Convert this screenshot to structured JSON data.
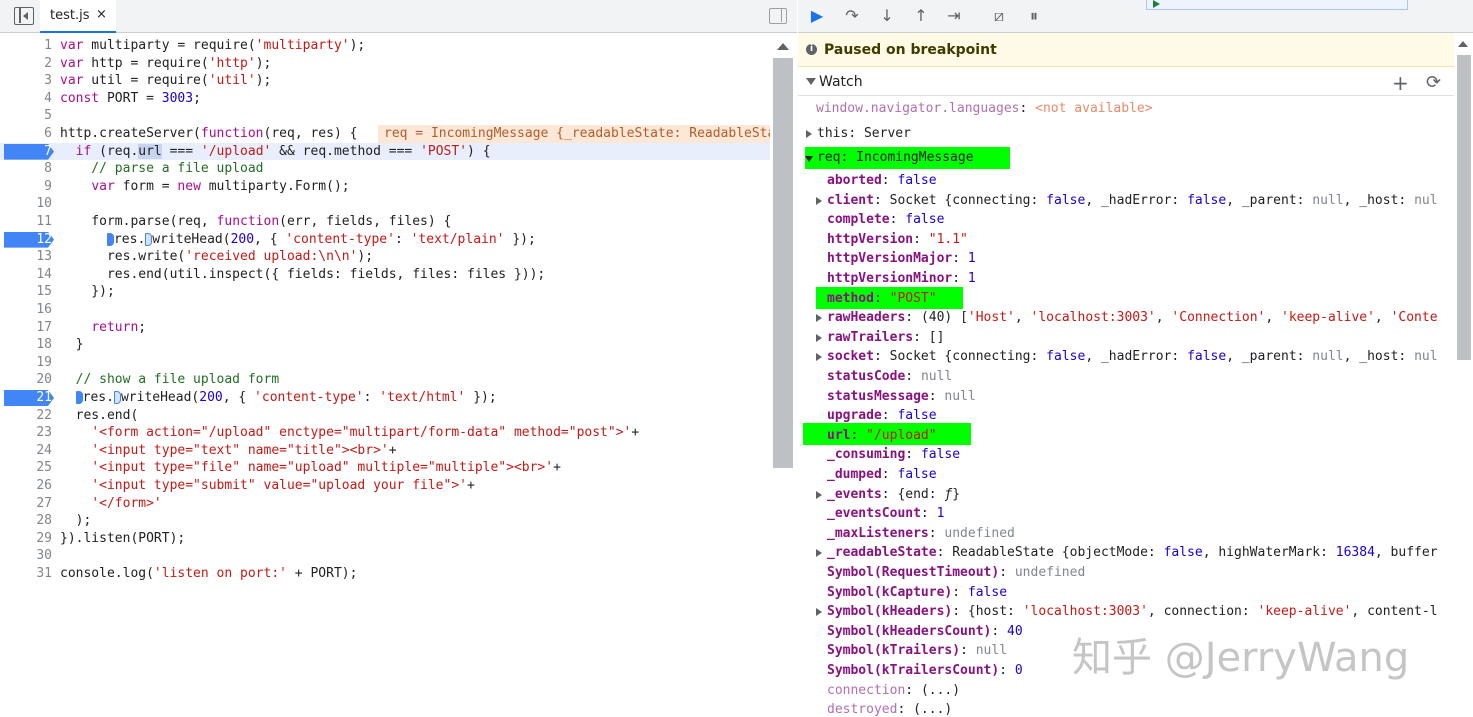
{
  "editor": {
    "tab_label": "test.js",
    "tab_close": "×",
    "lines": [
      {
        "n": "1"
      },
      {
        "n": "2"
      },
      {
        "n": "3"
      },
      {
        "n": "4"
      },
      {
        "n": "5"
      },
      {
        "n": "6"
      },
      {
        "n": "7"
      },
      {
        "n": "8"
      },
      {
        "n": "9"
      },
      {
        "n": "10"
      },
      {
        "n": "11"
      },
      {
        "n": "12"
      },
      {
        "n": "13"
      },
      {
        "n": "14"
      },
      {
        "n": "15"
      },
      {
        "n": "16"
      },
      {
        "n": "17"
      },
      {
        "n": "18"
      },
      {
        "n": "19"
      },
      {
        "n": "20"
      },
      {
        "n": "21"
      },
      {
        "n": "22"
      },
      {
        "n": "23"
      },
      {
        "n": "24"
      },
      {
        "n": "25"
      },
      {
        "n": "26"
      },
      {
        "n": "27"
      },
      {
        "n": "28"
      },
      {
        "n": "29"
      },
      {
        "n": "30"
      },
      {
        "n": "31"
      }
    ],
    "code": {
      "l1a": "var",
      "l1b": " multiparty = require(",
      "l1c": "'multiparty'",
      "l1d": ");",
      "l2a": "var",
      "l2b": " http = require(",
      "l2c": "'http'",
      "l2d": ");",
      "l3a": "var",
      "l3b": " util = require(",
      "l3c": "'util'",
      "l3d": ");",
      "l4a": "const",
      "l4b": " PORT = ",
      "l4c": "3003",
      "l4d": ";",
      "l6a": "http.createServer(",
      "l6b": "function",
      "l6c": "(req, res) {",
      "l6_inline": "req = IncomingMessage {_readableState: ReadableState",
      "l7a": "  ",
      "l7b": "if",
      "l7c": " (req.",
      "l7d": "url",
      "l7e": " === ",
      "l7f": "'/upload'",
      "l7g": " && req.method === ",
      "l7h": "'POST'",
      "l7i": ") {",
      "l8": "    // parse a file upload",
      "l9a": "    ",
      "l9b": "var",
      "l9c": " form = ",
      "l9d": "new",
      "l9e": " multiparty.Form();",
      "l11a": "    form.parse(req, ",
      "l11b": "function",
      "l11c": "(err, fields, files) {",
      "l12a": "res.",
      "l12b": "writeHead(",
      "l12c": "200",
      "l12d": ", { ",
      "l12e": "'content-type'",
      "l12f": ": ",
      "l12g": "'text/plain'",
      "l12h": " });",
      "l13a": "      res.write(",
      "l13b": "'received upload:\\n\\n'",
      "l13c": ");",
      "l14": "      res.end(util.inspect({ fields: fields, files: files }));",
      "l15": "    });",
      "l17a": "    ",
      "l17b": "return",
      "l17c": ";",
      "l18": "  }",
      "l20": "  // show a file upload form",
      "l21a": "res.",
      "l21b": "writeHead(",
      "l21c": "200",
      "l21d": ", { ",
      "l21e": "'content-type'",
      "l21f": ": ",
      "l21g": "'text/html'",
      "l21h": " });",
      "l22": "  res.end(",
      "l23a": "    ",
      "l23b": "'<form action=\"/upload\" enctype=\"multipart/form-data\" method=\"post\">'",
      "l23c": "+",
      "l24a": "    ",
      "l24b": "'<input type=\"text\" name=\"title\"><br>'",
      "l24c": "+",
      "l25a": "    ",
      "l25b": "'<input type=\"file\" name=\"upload\" multiple=\"multiple\"><br>'",
      "l25c": "+",
      "l26a": "    ",
      "l26b": "'<input type=\"submit\" value=\"upload your file\">'",
      "l26c": "+",
      "l27a": "    ",
      "l27b": "'</form>'",
      "l28": "  );",
      "l29": "}).listen(PORT);",
      "l31a": "console.log(",
      "l31b": "'listen on port:'",
      "l31c": " + PORT);"
    }
  },
  "debugger": {
    "paused_text": "Paused on breakpoint",
    "info_glyph": "i",
    "watch_label": "Watch",
    "watch_add": "+",
    "watch_refresh": "⟳",
    "buttons": {
      "resume": "▶",
      "step_over": "↷",
      "step_into": "↓",
      "step_out": "↑",
      "step": "⇥",
      "deactivate": "⧄",
      "pause_exceptions": "⏸"
    }
  },
  "watch": {
    "r0_name": "window.navigator.languages",
    "r0_sep": ": ",
    "r0_val": "<not available>",
    "r1_name": "this",
    "r1_sep": ": ",
    "r1_val": "Server",
    "r2_name": "req",
    "r2_sep": ": ",
    "r2_val": "IncomingMessage",
    "aborted_n": "aborted",
    "aborted_v": "false",
    "client_n": "client",
    "client_v1": "Socket {connecting: ",
    "client_v2": "false",
    "client_v3": ", _hadError: ",
    "client_v4": "false",
    "client_v5": ", _parent: ",
    "client_v6": "null",
    "client_v7": ", _host: ",
    "client_v8": "nul",
    "complete_n": "complete",
    "complete_v": "false",
    "httpVersion_n": "httpVersion",
    "httpVersion_v": "\"1.1\"",
    "httpVersionMajor_n": "httpVersionMajor",
    "httpVersionMajor_v": "1",
    "httpVersionMinor_n": "httpVersionMinor",
    "httpVersionMinor_v": "1",
    "method_n": "method",
    "method_v": "\"POST\"",
    "rawHeaders_n": "rawHeaders",
    "rawHeaders_v1": "(40) [",
    "rawHeaders_v2": "'Host'",
    "rawHeaders_v3": ", ",
    "rawHeaders_v4": "'localhost:3003'",
    "rawHeaders_v5": ", ",
    "rawHeaders_v6": "'Connection'",
    "rawHeaders_v7": ", ",
    "rawHeaders_v8": "'keep-alive'",
    "rawHeaders_v9": ", ",
    "rawHeaders_v10": "'Conte",
    "rawTrailers_n": "rawTrailers",
    "rawTrailers_v": "[]",
    "socket_n": "socket",
    "socket_v1": "Socket {connecting: ",
    "socket_v2": "false",
    "socket_v3": ", _hadError: ",
    "socket_v4": "false",
    "socket_v5": ", _parent: ",
    "socket_v6": "null",
    "socket_v7": ", _host: ",
    "socket_v8": "nul",
    "statusCode_n": "statusCode",
    "statusCode_v": "null",
    "statusMessage_n": "statusMessage",
    "statusMessage_v": "null",
    "upgrade_n": "upgrade",
    "upgrade_v": "false",
    "url_n": "url",
    "url_v": "\"/upload\"",
    "consuming_n": "_consuming",
    "consuming_v": "false",
    "dumped_n": "_dumped",
    "dumped_v": "false",
    "events_n": "_events",
    "events_v1": "{end: ",
    "events_v2": "ƒ",
    "events_v3": "}",
    "eventsCount_n": "_eventsCount",
    "eventsCount_v": "1",
    "maxListeners_n": "_maxListeners",
    "maxListeners_v": "undefined",
    "readableState_n": "_readableState",
    "readableState_v1": "ReadableState {objectMode: ",
    "readableState_v2": "false",
    "readableState_v3": ", highWaterMark: ",
    "readableState_v4": "16384",
    "readableState_v5": ", buffer",
    "sym1_n": "Symbol(RequestTimeout)",
    "sym1_v": "undefined",
    "sym2_n": "Symbol(kCapture)",
    "sym2_v": "false",
    "sym3_n": "Symbol(kHeaders)",
    "sym3_v1": "{host: ",
    "sym3_v2": "'localhost:3003'",
    "sym3_v3": ", connection: ",
    "sym3_v4": "'keep-alive'",
    "sym3_v5": ", content-l",
    "sym4_n": "Symbol(kHeadersCount)",
    "sym4_v": "40",
    "sym5_n": "Symbol(kTrailers)",
    "sym5_v": "null",
    "sym6_n": "Symbol(kTrailersCount)",
    "sym6_v": "0",
    "connection_n": "connection",
    "connection_v": "(...)",
    "destroyed_n": "destroyed",
    "destroyed_v": "(...)"
  },
  "watermark": "知乎 @JerryWang",
  "colors": {
    "breakpoint": "#4285f4",
    "highlight_marker": "#00ff00",
    "paused_banner": "#fffbe6"
  }
}
